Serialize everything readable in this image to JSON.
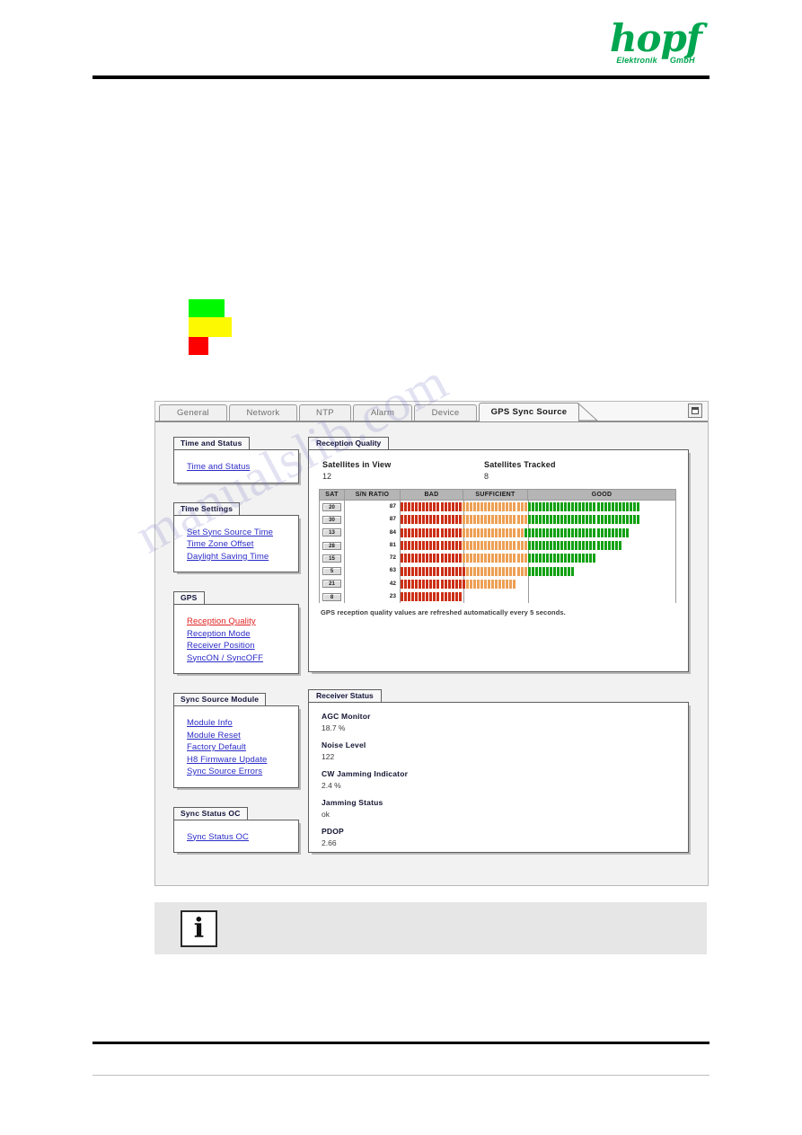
{
  "header": {
    "logo_word": "hopf",
    "logo_sub_left": "Elektronik",
    "logo_sub_right": "GmbH"
  },
  "legend_blocks": {
    "green_label": "green-block",
    "yellow_label": "yellow-block",
    "red_label": "red-block",
    "green_color": "#00f900",
    "yellow_color": "#fcf900",
    "red_color": "#fc0000"
  },
  "watermark": {
    "text": "manualslib.com"
  },
  "browser": {
    "tabs": [
      {
        "label": "General",
        "active": false
      },
      {
        "label": "Network",
        "active": false
      },
      {
        "label": "NTP",
        "active": false
      },
      {
        "label": "Alarm",
        "active": false
      },
      {
        "label": "Device",
        "active": false
      },
      {
        "label": "GPS Sync Source",
        "active": true
      }
    ],
    "restore_icon": "window-restore-icon"
  },
  "sidebar": {
    "groups": [
      {
        "title": "Time and Status",
        "items": [
          {
            "label": "Time and Status",
            "current": false
          }
        ]
      },
      {
        "title": "Time Settings",
        "items": [
          {
            "label": "Set Sync Source Time",
            "current": false
          },
          {
            "label": "Time Zone Offset",
            "current": false
          },
          {
            "label": "Daylight Saving Time",
            "current": false
          }
        ]
      },
      {
        "title": "GPS",
        "items": [
          {
            "label": "Reception Quality",
            "current": true
          },
          {
            "label": "Reception Mode",
            "current": false
          },
          {
            "label": "Receiver Position",
            "current": false
          },
          {
            "label": "SyncON / SyncOFF",
            "current": false
          }
        ]
      },
      {
        "title": "Sync Source Module",
        "items": [
          {
            "label": "Module Info",
            "current": false
          },
          {
            "label": "Module Reset",
            "current": false
          },
          {
            "label": "Factory Default",
            "current": false
          },
          {
            "label": "H8 Firmware Update",
            "current": false
          },
          {
            "label": "Sync Source Errors",
            "current": false
          }
        ]
      },
      {
        "title": "Sync Status OC",
        "items": [
          {
            "label": "Sync Status OC",
            "current": false
          }
        ]
      }
    ]
  },
  "reception_quality": {
    "panel_title": "Reception Quality",
    "satellites_in_view_label": "Satellites in View",
    "satellites_in_view_value": "12",
    "satellites_tracked_label": "Satellites Tracked",
    "satellites_tracked_value": "8",
    "note": "GPS reception quality values are refreshed automatically every 5 seconds."
  },
  "receiver_status": {
    "panel_title": "Receiver Status",
    "fields": [
      {
        "label": "AGC Monitor",
        "value": "18.7 %"
      },
      {
        "label": "Noise Level",
        "value": "122"
      },
      {
        "label": "CW Jamming Indicator",
        "value": "2.4 %"
      },
      {
        "label": "Jamming Status",
        "value": "ok"
      },
      {
        "label": "PDOP",
        "value": "2.66"
      }
    ]
  },
  "info_banner": {
    "icon": "information-icon",
    "glyph": "i"
  },
  "chart_data": {
    "type": "bar",
    "title": "Reception Quality",
    "xlabel": "S/N RATIO",
    "ylabel": "SAT",
    "xlim": [
      0,
      100
    ],
    "grid": false,
    "legend_position": "top",
    "columns": [
      "SAT",
      "S/N RATIO",
      "BAD",
      "SUFFICIENT",
      "GOOD"
    ],
    "zones": [
      {
        "name": "BAD",
        "range": [
          0,
          23
        ],
        "color": "#cc2f16"
      },
      {
        "name": "SUFFICIENT",
        "range": [
          23,
          46
        ],
        "color": "#eda055"
      },
      {
        "name": "GOOD",
        "range": [
          46,
          100
        ],
        "color": "#13a113"
      }
    ],
    "categories": [
      "20",
      "30",
      "13",
      "28",
      "15",
      "5",
      "21",
      "8"
    ],
    "values": [
      87,
      87,
      84,
      81,
      72,
      63,
      42,
      23
    ],
    "rows": [
      {
        "sat": "20",
        "snr": "87",
        "value": 87
      },
      {
        "sat": "30",
        "snr": "87",
        "value": 87
      },
      {
        "sat": "13",
        "snr": "84",
        "value": 84
      },
      {
        "sat": "28",
        "snr": "81",
        "value": 81
      },
      {
        "sat": "15",
        "snr": "72",
        "value": 72
      },
      {
        "sat": "5",
        "snr": "63",
        "value": 63
      },
      {
        "sat": "21",
        "snr": "42",
        "value": 42
      },
      {
        "sat": "8",
        "snr": "23",
        "value": 23
      }
    ]
  }
}
